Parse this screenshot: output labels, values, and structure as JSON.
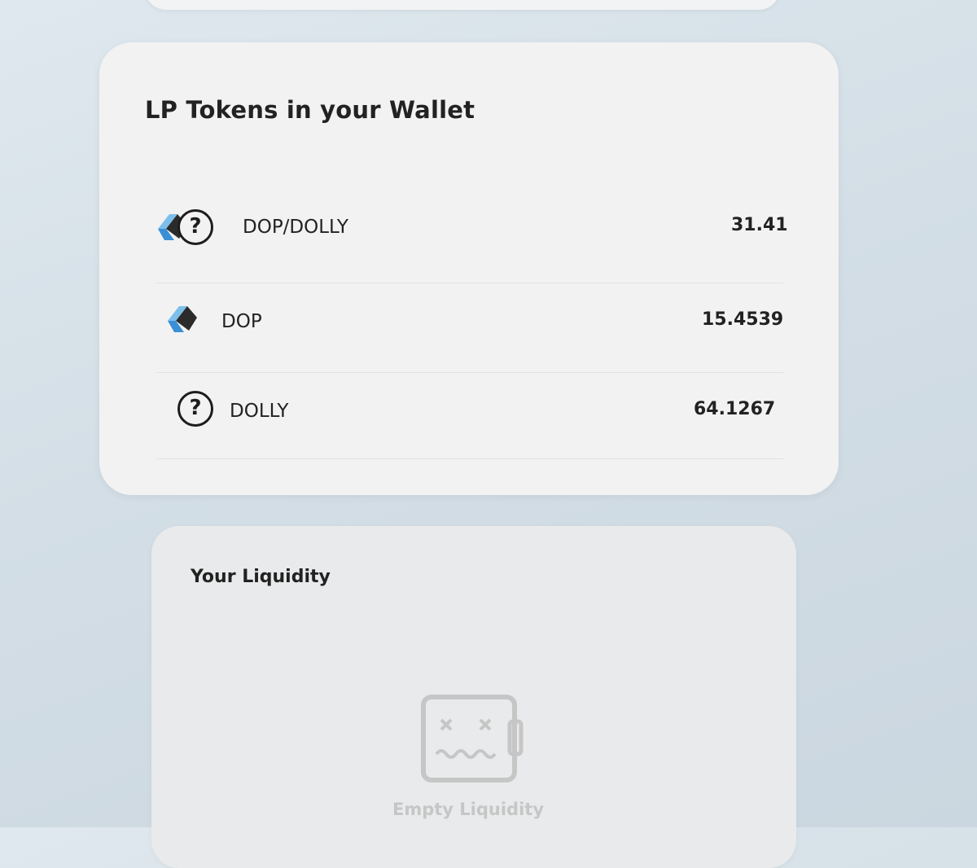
{
  "wallet_section": {
    "title": "LP Tokens in your Wallet",
    "tokens": [
      {
        "label": "DOP/DOLLY",
        "amount": "31.41",
        "icon": "dop-logo-and-unknown-token-icon"
      },
      {
        "label": "DOP",
        "amount": "15.4539",
        "icon": "dop-logo-icon"
      },
      {
        "label": "DOLLY",
        "amount": "64.1267",
        "icon": "unknown-token-icon"
      }
    ]
  },
  "liquidity_section": {
    "title": "Your Liquidity",
    "empty_icon": "empty-wallet-icon",
    "empty_text": "Empty Liquidity"
  },
  "icons": {
    "question_glyph": "?"
  },
  "colors": {
    "dop_logo_light": "#7cc0ea",
    "dop_logo_blue": "#3a8fd6",
    "dop_logo_dark": "#2b2b2b",
    "empty_state_gray": "#c6c6c6"
  }
}
